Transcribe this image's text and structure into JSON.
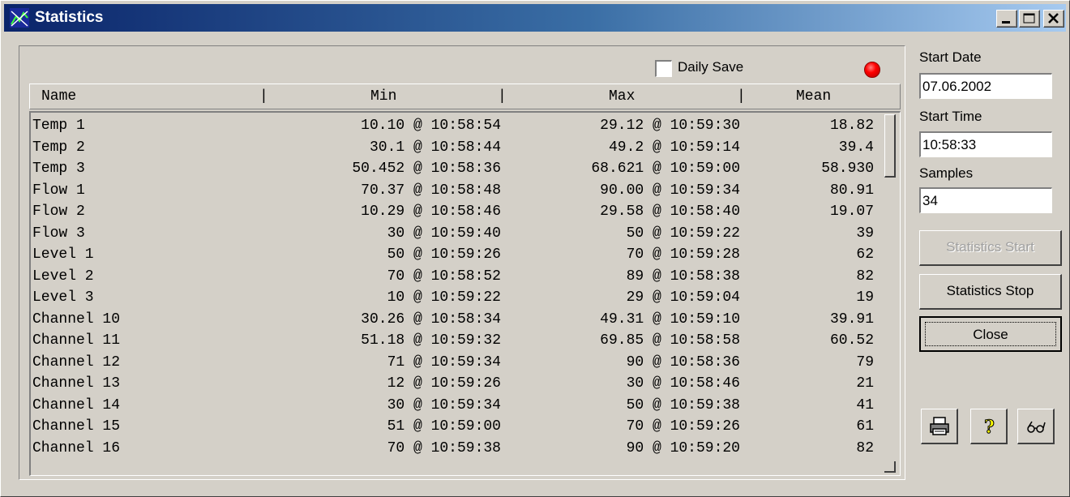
{
  "window": {
    "title": "Statistics"
  },
  "options": {
    "daily_save_label": "Daily Save",
    "daily_save_checked": false
  },
  "table": {
    "columns": [
      "Name",
      "Min",
      "Max",
      "Mean"
    ],
    "rows": [
      {
        "name": "Temp 1",
        "min": "10.10 @ 10:58:54",
        "max": "29.12 @ 10:59:30",
        "mean": "18.82"
      },
      {
        "name": "Temp 2",
        "min": "30.1 @ 10:58:44",
        "max": "49.2 @ 10:59:14",
        "mean": "39.4"
      },
      {
        "name": "Temp 3",
        "min": "50.452 @ 10:58:36",
        "max": "68.621 @ 10:59:00",
        "mean": "58.930"
      },
      {
        "name": "Flow 1",
        "min": "70.37 @ 10:58:48",
        "max": "90.00 @ 10:59:34",
        "mean": "80.91"
      },
      {
        "name": "Flow 2",
        "min": "10.29 @ 10:58:46",
        "max": "29.58 @ 10:58:40",
        "mean": "19.07"
      },
      {
        "name": "Flow 3",
        "min": "30 @ 10:59:40",
        "max": "50 @ 10:59:22",
        "mean": "39"
      },
      {
        "name": "Level 1",
        "min": "50 @ 10:59:26",
        "max": "70 @ 10:59:28",
        "mean": "62"
      },
      {
        "name": "Level 2",
        "min": "70 @ 10:58:52",
        "max": "89 @ 10:58:38",
        "mean": "82"
      },
      {
        "name": "Level 3",
        "min": "10 @ 10:59:22",
        "max": "29 @ 10:59:04",
        "mean": "19"
      },
      {
        "name": "Channel 10",
        "min": "30.26 @ 10:58:34",
        "max": "49.31 @ 10:59:10",
        "mean": "39.91"
      },
      {
        "name": "Channel 11",
        "min": "51.18 @ 10:59:32",
        "max": "69.85 @ 10:58:58",
        "mean": "60.52"
      },
      {
        "name": "Channel 12",
        "min": "71 @ 10:59:34",
        "max": "90 @ 10:58:36",
        "mean": "79"
      },
      {
        "name": "Channel 13",
        "min": "12 @ 10:59:26",
        "max": "30 @ 10:58:46",
        "mean": "21"
      },
      {
        "name": "Channel 14",
        "min": "30 @ 10:59:34",
        "max": "50 @ 10:59:38",
        "mean": "41"
      },
      {
        "name": "Channel 15",
        "min": "51 @ 10:59:00",
        "max": "70 @ 10:59:26",
        "mean": "61"
      },
      {
        "name": "Channel 16",
        "min": "70 @ 10:59:38",
        "max": "90 @ 10:59:20",
        "mean": "82"
      }
    ]
  },
  "side": {
    "start_date_label": "Start Date",
    "start_date": "07.06.2002",
    "start_time_label": "Start Time",
    "start_time": "10:58:33",
    "samples_label": "Samples",
    "samples": "34",
    "start_button": "Statistics Start",
    "stop_button": "Statistics Stop",
    "close_button": "Close"
  },
  "icons": [
    "print-icon",
    "help-icon",
    "glasses-icon"
  ],
  "colors": {
    "title_start": "#0a246a",
    "title_end": "#a6caf0",
    "face": "#d4d0c8",
    "led": "#ff0000"
  }
}
